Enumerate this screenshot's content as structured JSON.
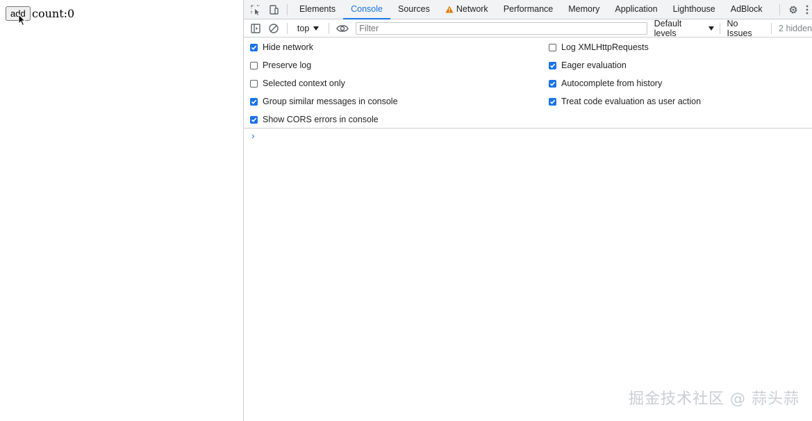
{
  "page": {
    "button_label": "add",
    "count_text": "count:0"
  },
  "devtools": {
    "tabs": [
      {
        "label": "Elements"
      },
      {
        "label": "Console"
      },
      {
        "label": "Sources"
      },
      {
        "label": "Network"
      },
      {
        "label": "Performance"
      },
      {
        "label": "Memory"
      },
      {
        "label": "Application"
      },
      {
        "label": "Lighthouse"
      },
      {
        "label": "AdBlock"
      }
    ],
    "active_tab": "Console",
    "accent": "#1a73e8",
    "toolbar": {
      "context": "top",
      "filter_placeholder": "Filter",
      "levels": "Default levels",
      "issues": "No Issues",
      "hidden": "2 hidden"
    },
    "settings": {
      "left": [
        {
          "label": "Hide network",
          "checked": true
        },
        {
          "label": "Preserve log",
          "checked": false
        },
        {
          "label": "Selected context only",
          "checked": false
        },
        {
          "label": "Group similar messages in console",
          "checked": true
        },
        {
          "label": "Show CORS errors in console",
          "checked": true
        }
      ],
      "right": [
        {
          "label": "Log XMLHttpRequests",
          "checked": false
        },
        {
          "label": "Eager evaluation",
          "checked": true
        },
        {
          "label": "Autocomplete from history",
          "checked": true
        },
        {
          "label": "Treat code evaluation as user action",
          "checked": true
        }
      ]
    }
  },
  "watermark": "掘金技术社区 @ 蒜头蒜"
}
